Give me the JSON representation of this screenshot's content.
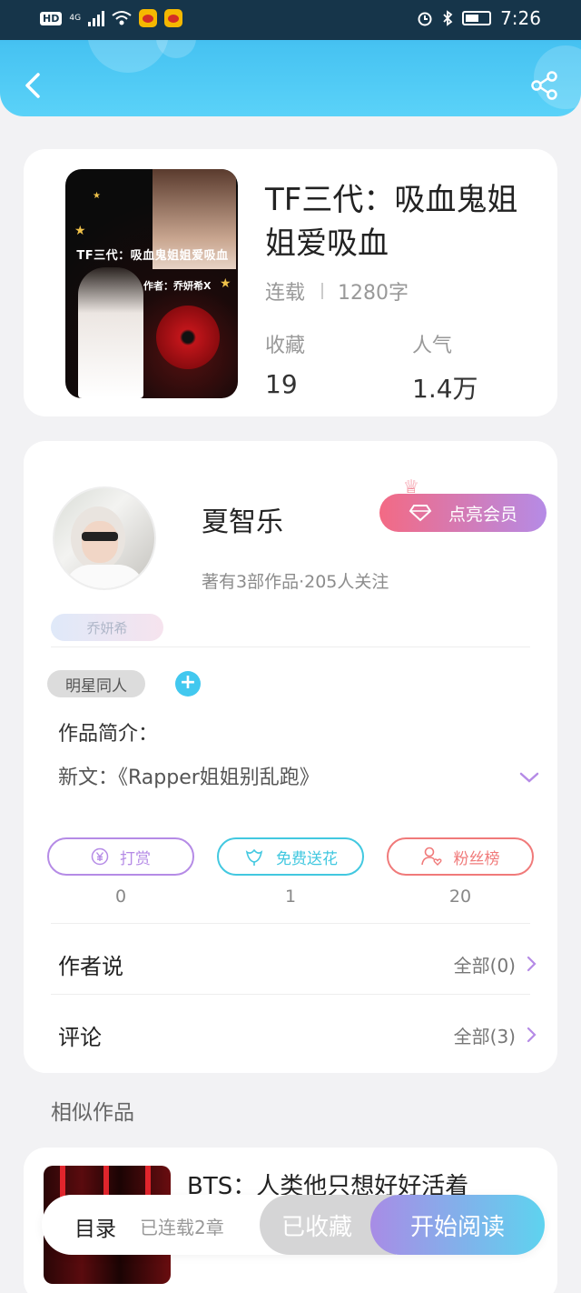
{
  "status_bar": {
    "network_hd": "HD",
    "network_4g": "4G",
    "time": "7:26"
  },
  "book": {
    "title": "TF三代：吸血鬼姐姐爱吸血",
    "cover_title": "TF三代：吸血鬼姐姐爱吸血",
    "cover_author": "作者：乔妍希X",
    "status": "连载",
    "word_count": "1280字",
    "favorites_label": "收藏",
    "favorites_value": "19",
    "popularity_label": "人气",
    "popularity_value": "1.4万"
  },
  "author": {
    "name": "夏智乐",
    "stats": "著有3部作品·205人关注",
    "vip_button": "点亮会员",
    "name_tag": "乔妍希",
    "tag": "明星同人",
    "add_tag": "+",
    "intro_label": "作品简介：",
    "intro_text": "新文：《Rapper姐姐别乱跑》"
  },
  "actions": [
    {
      "label": "打赏",
      "count": "0",
      "color": "#b58be6"
    },
    {
      "label": "免费送花",
      "count": "1",
      "color": "#42c8e0"
    },
    {
      "label": "粉丝榜",
      "count": "20",
      "color": "#f07a7a"
    }
  ],
  "rows": {
    "author_says_label": "作者说",
    "author_says_value": "全部(0)",
    "comments_label": "评论",
    "comments_value": "全部(3)"
  },
  "similar": {
    "section_title": "相似作品",
    "first_title": "BTS：人类他只想好好活着"
  },
  "bottom_bar": {
    "toc": "目录",
    "status": "已连载2章",
    "favorited": "已收藏",
    "start_reading": "开始阅读"
  },
  "colors": {
    "header": "#47c3f2",
    "accent_purple": "#b58be6",
    "accent_pink": "#f36a84"
  }
}
